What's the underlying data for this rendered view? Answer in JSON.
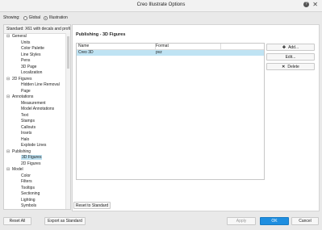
{
  "window": {
    "title": "Creo Illustrate Options"
  },
  "showing": {
    "label": "Showing:",
    "options": [
      {
        "label": "Global",
        "selected": false
      },
      {
        "label": "Illustration",
        "selected": true
      }
    ]
  },
  "left_panel": {
    "header": "Standard: X61 with decals and profi",
    "tree": [
      {
        "label": "General",
        "expanded": true,
        "children": [
          "Units",
          "Color Palette",
          "Line Styles",
          "Pens",
          "3D Page",
          "Localization"
        ]
      },
      {
        "label": "2D Figures",
        "expanded": true,
        "children": [
          "Hidden Line Removal",
          "Page"
        ]
      },
      {
        "label": "Annotations",
        "expanded": true,
        "children": [
          "Measurement",
          "Model Annotations",
          "Text",
          "Stamps",
          "Callouts",
          "Insets",
          "Halo",
          "Explode Lines"
        ]
      },
      {
        "label": "Publishing",
        "expanded": true,
        "children": [
          "3D Figures",
          "2D Figures"
        ]
      },
      {
        "label": "Model",
        "expanded": true,
        "children": [
          "Color",
          "Filters",
          "Tooltips",
          "Sectioning",
          "Lighting",
          "Symbols",
          "Decals"
        ]
      }
    ],
    "selected": "3D Figures"
  },
  "main": {
    "title": "Publishing - 3D Figures",
    "table": {
      "columns": [
        "Name",
        "Format"
      ],
      "rows": [
        {
          "name": "Creo 3D",
          "format": "pvz"
        }
      ]
    },
    "buttons": {
      "add": "Add...",
      "edit": "Edit...",
      "delete": "Delete"
    },
    "reset_to_standard": "Reset to Standard"
  },
  "bottom": {
    "reset_all": "Reset All",
    "export_as_standard": "Export as Standard",
    "apply": "Apply",
    "ok": "OK",
    "cancel": "Cancel"
  },
  "colors": {
    "accent": "#1e8ee0",
    "selection": "#bfe3f3"
  }
}
